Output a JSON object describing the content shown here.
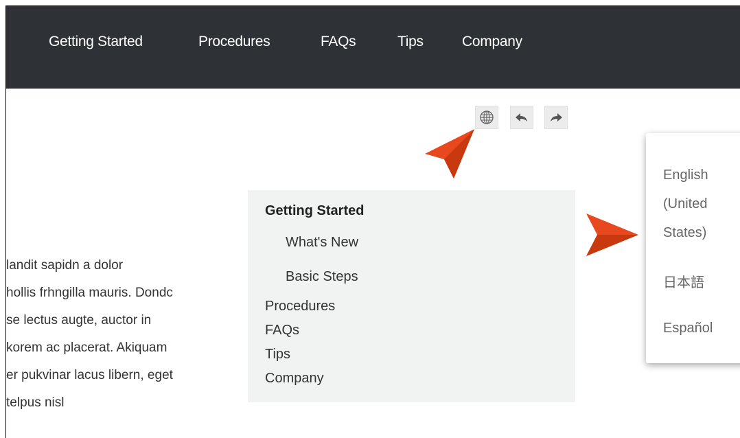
{
  "nav": {
    "items": [
      "Getting Started",
      "Procedures",
      "FAQs",
      "Tips",
      "Company"
    ]
  },
  "toolbar": {
    "language_icon": "globe-icon",
    "back_icon": "reply-arrow-icon",
    "forward_icon": "forward-arrow-icon"
  },
  "annotation": {
    "color": "#e8481e"
  },
  "body_text": {
    "lines": [
      "landit sapidn a dolor",
      "hollis frhngilla mauris. Dondc",
      "se lectus augte, auctor in",
      "korem ac placerat. Akiquam",
      "er pukvinar lacus libern, eget",
      " telpus nisl"
    ]
  },
  "toc": {
    "heading": "Getting Started",
    "subitems": [
      "What's New",
      "Basic Steps"
    ],
    "items": [
      "Procedures",
      "FAQs",
      "Tips",
      "Company"
    ]
  },
  "language_menu": {
    "options": [
      "English (United States)",
      "日本語",
      "Español"
    ]
  },
  "colors": {
    "nav_bg": "#2e3135",
    "toc_bg": "#f1f2f2",
    "arrow": "#e8481e"
  }
}
